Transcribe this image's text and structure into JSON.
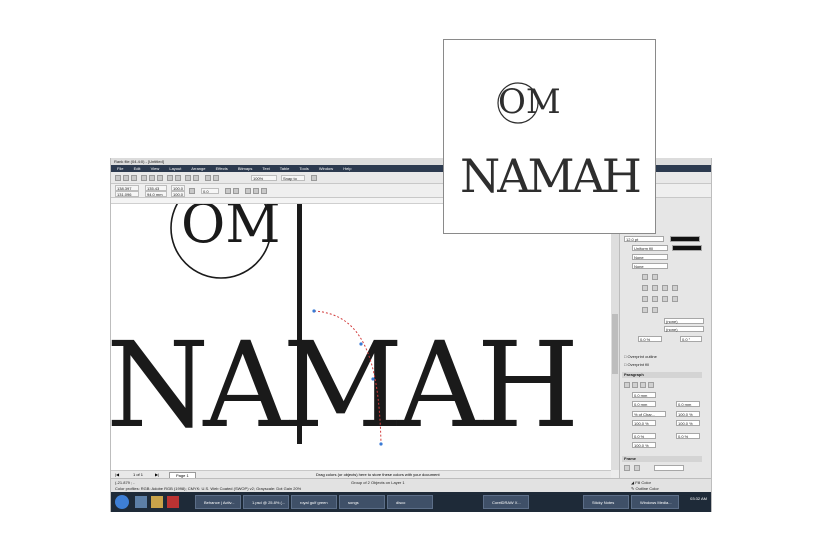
{
  "app": {
    "title": "Rank file (04.4:0) - [Untitled]",
    "menu": [
      "File",
      "Edit",
      "View",
      "Layout",
      "Arrange",
      "Effects",
      "Bitmaps",
      "Text",
      "Table",
      "Tools",
      "Window",
      "Help"
    ]
  },
  "standard_toolbar": {
    "zoom": "100%",
    "snap_to": "Snap to"
  },
  "property_bar": {
    "x": "138.397 mm",
    "y": "131.096 mm",
    "w": "135.43 mm",
    "h": "94.0 mm",
    "scale_x": "100.0",
    "scale_y": "100.0",
    "angle": "0.0"
  },
  "artwork": {
    "line1": "OM",
    "line2": "NAMAH"
  },
  "page_nav": {
    "counter": "1 of 1",
    "tab": "Page 1"
  },
  "hint": "Drag colors (or objects) here to store these colors with your document",
  "status": {
    "coords": "(-21.879 ; -",
    "selection": "Group of 2 Objects on Layer 1",
    "profile": "Color profiles: RGB: Adobe RGB (1998); CMYK: U.S. Web Coated (SWOP) v2; Grayscale: Dot Gain 20%",
    "fill_label": "Fill Color",
    "outline_label": "Outline Color"
  },
  "docker": {
    "outline_width": "12.0 pt",
    "fill_type": "Uniform fill",
    "none_label": "None",
    "char_style_1": "(none)",
    "char_style_2": "(none)",
    "char_spacing": "0.0 %",
    "char_angle": "0.0 °",
    "overprint_outline": "Overprint outline",
    "overprint_fill": "Overprint fill",
    "paragraph_title": "Paragraph",
    "indent_1": "0.0 mm",
    "indent_2": "0.0 mm",
    "indent_3": "0.0 mm",
    "spacing_unit": "% of Char...",
    "spacing_1": "100.0 %",
    "spacing_2": "100.0 %",
    "spacing_3": "100.0 %",
    "spacing_4": "0.0 %",
    "spacing_5": "0.0 %",
    "spacing_6": "100.0 %",
    "frame_title": "Frame",
    "columns_label": "Columns..."
  },
  "taskbar": {
    "items": [
      "Behance | Activ...",
      "1.psd @ 25.8% (...",
      "royal gulf green",
      "songs",
      "disco",
      "CorelDRAW X...",
      "Sticky Notes",
      "Windows Media..."
    ],
    "clock": "03:32 AM"
  },
  "colors": {
    "ink": "#1a1a1a",
    "selection_accent": "#3a7bd5",
    "curve_node": "#ff0000"
  }
}
